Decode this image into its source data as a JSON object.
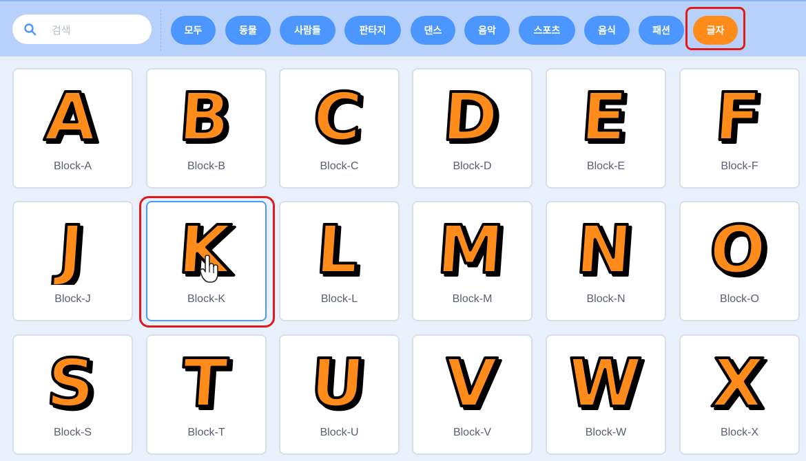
{
  "search": {
    "placeholder": "검색",
    "icon": "search-icon"
  },
  "categories": [
    {
      "label": "모두"
    },
    {
      "label": "동물"
    },
    {
      "label": "사람들"
    },
    {
      "label": "판타지"
    },
    {
      "label": "댄스"
    },
    {
      "label": "음악"
    },
    {
      "label": "스포츠"
    },
    {
      "label": "음식"
    },
    {
      "label": "패션"
    },
    {
      "label": "글자",
      "active": true
    }
  ],
  "sprites": [
    {
      "letter": "A",
      "name": "Block-A"
    },
    {
      "letter": "B",
      "name": "Block-B"
    },
    {
      "letter": "C",
      "name": "Block-C"
    },
    {
      "letter": "D",
      "name": "Block-D"
    },
    {
      "letter": "E",
      "name": "Block-E"
    },
    {
      "letter": "F",
      "name": "Block-F"
    },
    {
      "letter": "J",
      "name": "Block-J"
    },
    {
      "letter": "K",
      "name": "Block-K",
      "hovered": true
    },
    {
      "letter": "L",
      "name": "Block-L"
    },
    {
      "letter": "M",
      "name": "Block-M"
    },
    {
      "letter": "N",
      "name": "Block-N"
    },
    {
      "letter": "O",
      "name": "Block-O"
    },
    {
      "letter": "S",
      "name": "Block-S"
    },
    {
      "letter": "T",
      "name": "Block-T"
    },
    {
      "letter": "U",
      "name": "Block-U"
    },
    {
      "letter": "V",
      "name": "Block-V"
    },
    {
      "letter": "W",
      "name": "Block-W"
    },
    {
      "letter": "X",
      "name": "Block-X"
    }
  ],
  "colors": {
    "accent": "#4c97ff",
    "active": "#ff8c1a",
    "letter_fill": "#ff8c1a",
    "letter_outline": "#000000",
    "highlight": "#e01a1a"
  }
}
